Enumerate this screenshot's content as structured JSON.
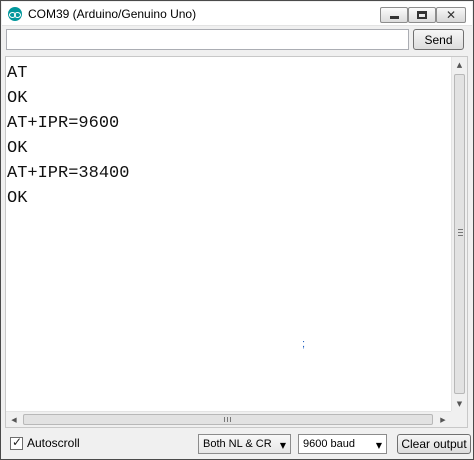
{
  "window": {
    "title": "COM39 (Arduino/Genuino Uno)"
  },
  "send": {
    "input_value": "",
    "button_label": "Send"
  },
  "output": {
    "lines": [
      "AT",
      "OK",
      "AT+IPR=9600",
      "OK",
      "AT+IPR=38400",
      "OK"
    ],
    "stray_mark": ";"
  },
  "bottom": {
    "autoscroll_label": "Autoscroll",
    "autoscroll_checked": true,
    "line_ending": "Both NL & CR",
    "baud": "9600 baud",
    "clear_label": "Clear output"
  },
  "colors": {
    "app_icon": "#00979c",
    "background": "#f0f0f0"
  }
}
